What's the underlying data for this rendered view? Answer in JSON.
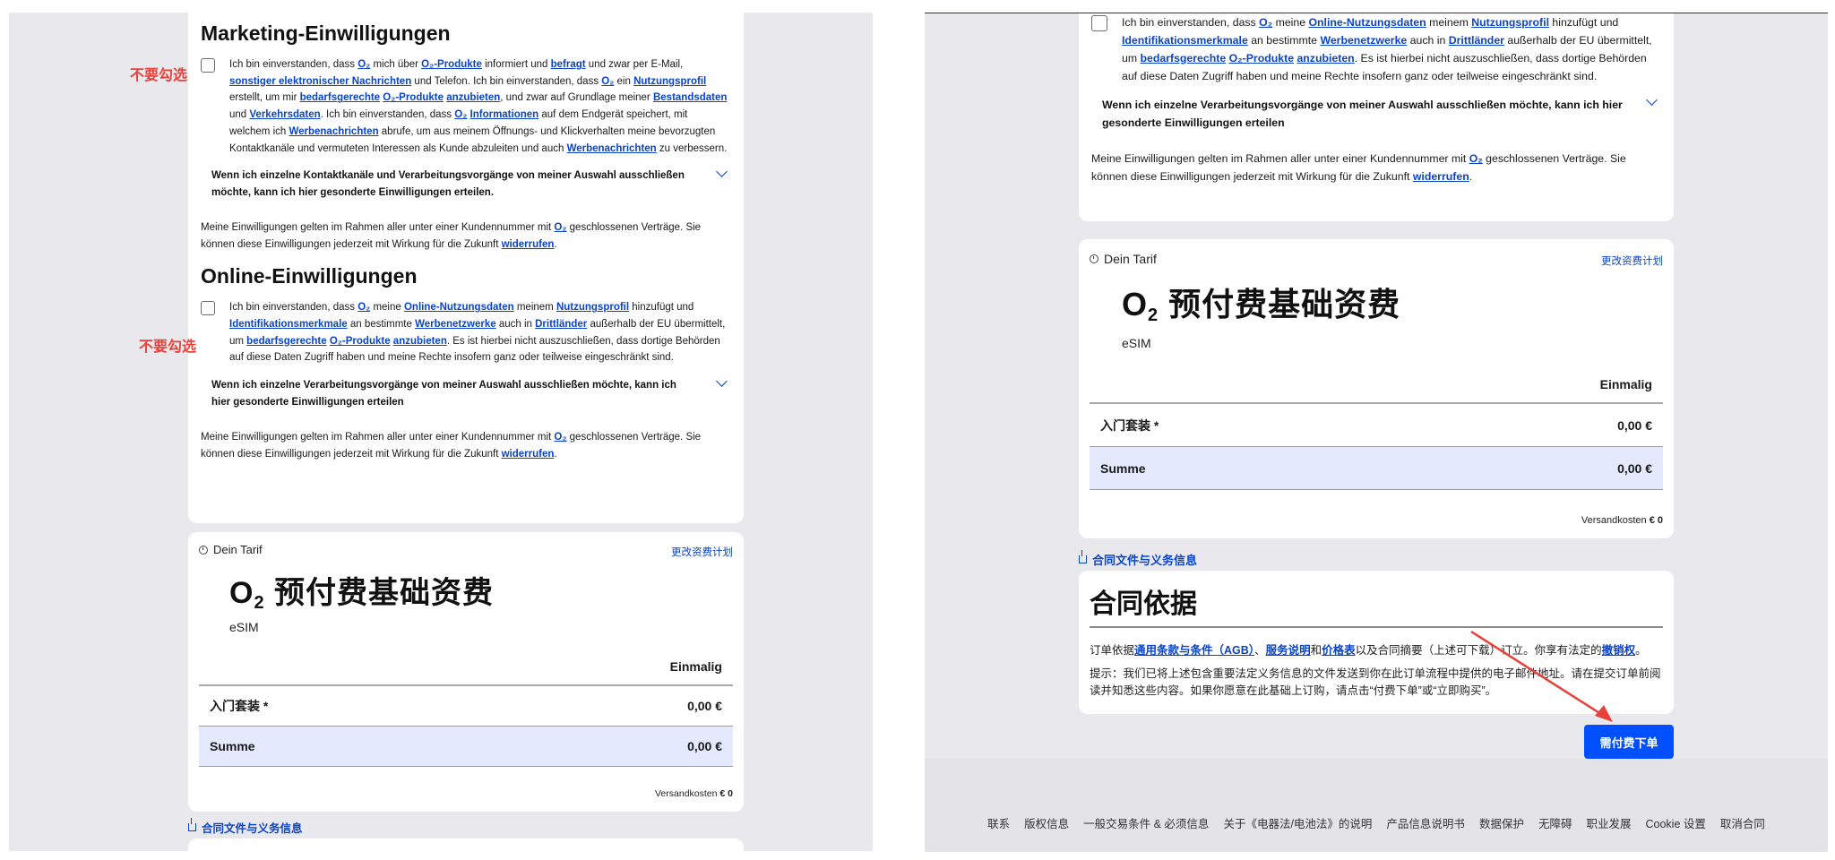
{
  "annotations": {
    "do_not_check": "不要勾选"
  },
  "marketing": {
    "title": "Marketing-Einwilligungen",
    "consent_segments": [
      "Ich bin einverstanden, dass ",
      {
        "link": "O₂"
      },
      " mich über ",
      {
        "link": "O₂-Produkte"
      },
      " informiert und ",
      {
        "link": "befragt"
      },
      " und zwar per E-Mail, ",
      {
        "link": "sonstiger elektronischer Nachrichten"
      },
      " und Telefon. Ich bin einverstanden, dass ",
      {
        "link": "O₂"
      },
      " ein ",
      {
        "link": "Nutzungsprofil"
      },
      " erstellt, um mir ",
      {
        "link": "bedarfsgerechte"
      },
      " ",
      {
        "link": "O₂-Produkte"
      },
      " ",
      {
        "link": "anzubieten"
      },
      ", und zwar auf Grundlage meiner ",
      {
        "link": "Bestandsdaten"
      },
      " und ",
      {
        "link": "Verkehrsdaten"
      },
      ". Ich bin einverstanden, dass ",
      {
        "link": "O₂"
      },
      " ",
      {
        "link": "Informationen"
      },
      " auf dem Endgerät speichert, mit welchem ich ",
      {
        "link": "Werbenachrichten"
      },
      " abrufe, um aus meinem Öffnungs- und Klickverhalten meine bevorzugten Kontaktkanäle und vermuteten Interessen als Kunde abzuleiten und auch ",
      {
        "link": "Werbenachrichten"
      },
      " zu verbessern."
    ],
    "accordion": "Wenn ich einzelne Kontaktkanäle und Verarbeitungsvorgänge von meiner Auswahl ausschließen möchte, kann ich hier gesonderte Einwilligungen erteilen.",
    "footnote_segments": [
      "Meine Einwilligungen gelten im Rahmen aller unter einer Kundennummer mit ",
      {
        "link": "O₂"
      },
      " geschlossenen Verträge. Sie können diese Einwilligungen jederzeit mit Wirkung für die Zukunft ",
      {
        "link": "widerrufen"
      },
      "."
    ]
  },
  "online": {
    "title": "Online-Einwilligungen",
    "consent_segments": [
      "Ich bin einverstanden, dass ",
      {
        "link": "O₂"
      },
      " meine ",
      {
        "link": "Online-Nutzungsdaten"
      },
      " meinem ",
      {
        "link": "Nutzungsprofil"
      },
      " hinzufügt und ",
      {
        "link": "Identifikationsmerkmale"
      },
      " an bestimmte ",
      {
        "link": "Werbenetzwerke"
      },
      " auch in ",
      {
        "link": "Drittländer"
      },
      " außerhalb der EU übermittelt, um ",
      {
        "link": "bedarfsgerechte"
      },
      " ",
      {
        "link": "O₂-Produkte"
      },
      " ",
      {
        "link": "anzubieten"
      },
      ". Es ist hierbei nicht auszuschließen, dass dortige Behörden auf diese Daten Zugriff haben und meine Rechte insofern ganz oder teilweise eingeschränkt sind."
    ],
    "accordion": "Wenn ich einzelne Verarbeitungsvorgänge von meiner Auswahl ausschließen möchte, kann ich hier gesonderte Einwilligungen erteilen",
    "footnote_segments": [
      "Meine Einwilligungen gelten im Rahmen aller unter einer Kundennummer mit ",
      {
        "link": "O₂"
      },
      " geschlossenen Verträge. Sie können diese Einwilligungen jederzeit mit Wirkung für die Zukunft ",
      {
        "link": "widerrufen"
      },
      "."
    ]
  },
  "tariff": {
    "heading": "Dein Tarif",
    "change_plan": "更改资费计划",
    "plan_prefix": "O",
    "plan_sub": "2",
    "plan_rest": " 预付费基础资费",
    "sim_type": "eSIM",
    "col_head": "Einmalig",
    "rows": [
      {
        "label": "入门套装 *",
        "value": "0,00 €"
      },
      {
        "label": "Summe",
        "value": "0,00 €"
      }
    ],
    "shipping_label": "Versandkosten ",
    "shipping_value": "€ 0"
  },
  "docs_link": "合同文件与义务信息",
  "basis": {
    "title": "合同依据",
    "para1_segments": [
      "订单依据",
      {
        "link": "通用条款与条件（AGB）"
      },
      "、",
      {
        "link": "服务说明"
      },
      "和",
      {
        "link": "价格表"
      },
      "以及合同摘要（上述可下载）订立。你享有法定的",
      {
        "link": "撤销权"
      },
      "。"
    ],
    "para2": "提示：我们已将上述包含重要法定义务信息的文件发送到你在此订单流程中提供的电子邮件地址。请在提交订单前阅读并知悉这些内容。如果你愿意在此基础上订购，请点击“付费下单”或“立即购买”。"
  },
  "order_button": "需付费下单",
  "footer": [
    "联系",
    "版权信息",
    "一般交易条件 & 必须信息",
    "关于《电器法/电池法》的说明",
    "产品信息说明书",
    "数据保护",
    "无障碍",
    "职业发展",
    "Cookie 设置",
    "取消合同"
  ],
  "colors": {
    "accent": "#0050ff",
    "link": "#0a44c9",
    "annotation": "#e8413c",
    "sum_row": "#e4e9fc"
  }
}
